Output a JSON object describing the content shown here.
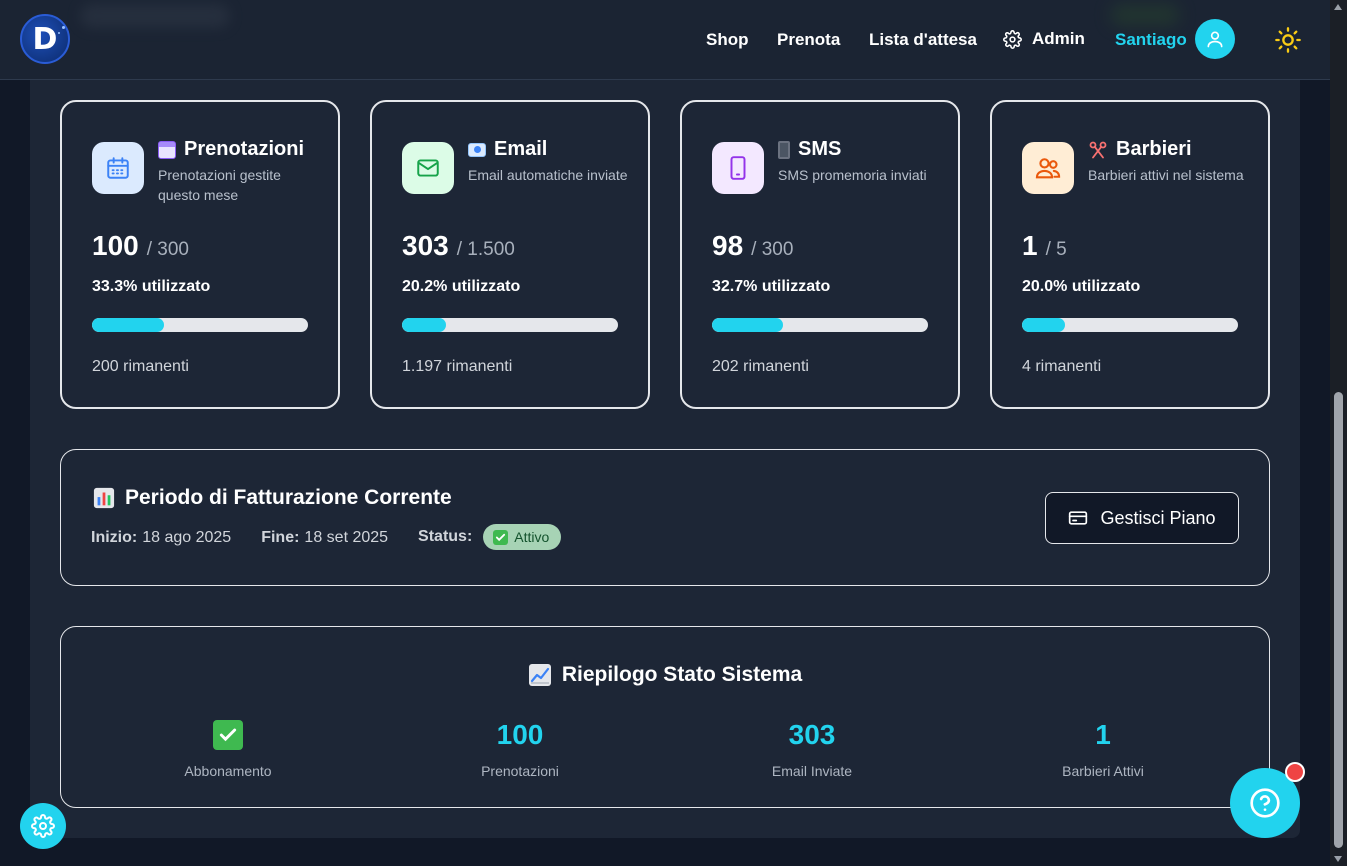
{
  "header": {
    "logo_letter": "D",
    "nav": {
      "shop": "Shop",
      "prenota": "Prenota",
      "waitlist": "Lista d'attesa",
      "admin": "Admin"
    },
    "user_name": "Santiago"
  },
  "cards": [
    {
      "title": "Prenotazioni",
      "description": "Prenotazioni gestite questo mese",
      "value": "100",
      "limit": "/ 300",
      "percent_label": "33.3% utilizzato",
      "fill_fraction": 0.333,
      "remaining": "200 rimanenti",
      "icon": "calendar-icon",
      "icon_bg": "#dbeafe",
      "icon_color": "#3b82f6"
    },
    {
      "title": "Email",
      "description": "Email automatiche inviate",
      "value": "303",
      "limit": "/ 1.500",
      "percent_label": "20.2% utilizzato",
      "fill_fraction": 0.202,
      "remaining": "1.197 rimanenti",
      "icon": "mail-icon",
      "icon_bg": "#dcfce7",
      "icon_color": "#16a34a"
    },
    {
      "title": "SMS",
      "description": "SMS promemoria inviati",
      "value": "98",
      "limit": "/ 300",
      "percent_label": "32.7% utilizzato",
      "fill_fraction": 0.327,
      "remaining": "202 rimanenti",
      "icon": "phone-icon",
      "icon_bg": "#f3e8ff",
      "icon_color": "#9333ea"
    },
    {
      "title": "Barbieri",
      "description": "Barbieri attivi nel sistema",
      "value": "1",
      "limit": "/ 5",
      "percent_label": "20.0% utilizzato",
      "fill_fraction": 0.2,
      "remaining": "4 rimanenti",
      "icon": "users-icon",
      "icon_bg": "#ffedd5",
      "icon_color": "#ea580c"
    }
  ],
  "billing": {
    "title": "Periodo di Fatturazione Corrente",
    "start_label": "Inizio:",
    "start_value": "18 ago 2025",
    "end_label": "Fine:",
    "end_value": "18 set 2025",
    "status_label": "Status:",
    "status_value": "Attivo",
    "manage_button": "Gestisci Piano"
  },
  "summary": {
    "title": "Riepilogo Stato Sistema",
    "stats": [
      {
        "value": "",
        "label": "Abbonamento",
        "icon": "check-icon"
      },
      {
        "value": "100",
        "label": "Prenotazioni"
      },
      {
        "value": "303",
        "label": "Email Inviate"
      },
      {
        "value": "1",
        "label": "Barbieri Attivi"
      }
    ]
  },
  "colors": {
    "accent": "#22d3ee",
    "background": "#111827",
    "panel": "#1d2636",
    "notification": "#ef4444"
  }
}
